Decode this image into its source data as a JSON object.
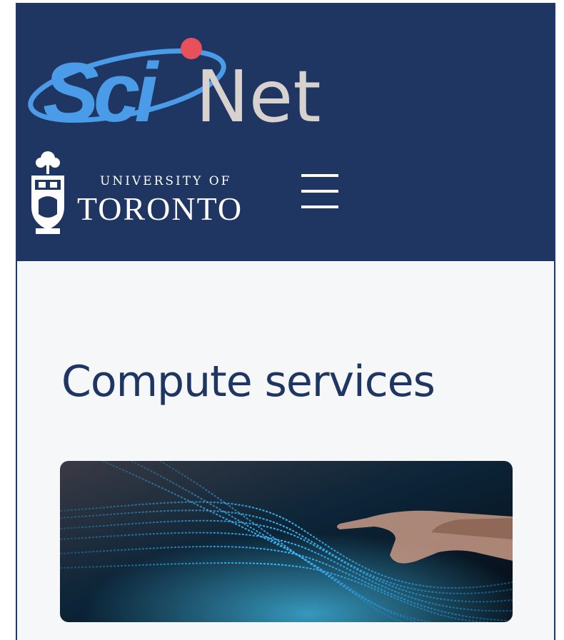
{
  "header": {
    "brand": {
      "sci": "Sci",
      "net": "Net"
    },
    "university": {
      "line1": "UNIVERSITY OF",
      "line2": "TORONTO"
    },
    "menu_icon": "hamburger-icon"
  },
  "main": {
    "title": "Compute services",
    "hero_image": "hand-touching-digital-data-stream"
  },
  "colors": {
    "header_bg": "#1f3562",
    "page_bg": "#f6f7f8",
    "title": "#1f3562",
    "sci_blue": "#4a9be8",
    "net_gray": "#d7d2cd",
    "dot_red": "#e8505b"
  }
}
